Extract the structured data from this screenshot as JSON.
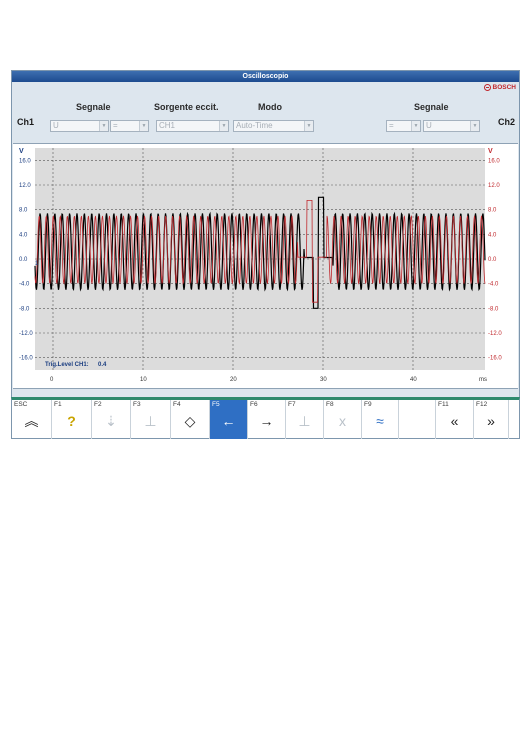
{
  "window": {
    "title": "Oscilloscopio",
    "brand": "BOSCH"
  },
  "channels": {
    "left": "Ch1",
    "right": "Ch2"
  },
  "headers": {
    "segnale_left": "Segnale",
    "sorgente": "Sorgente eccit.",
    "modo": "Modo",
    "segnale_right": "Segnale"
  },
  "controls": {
    "ch1_signal": "U",
    "ch1_coupling": "=",
    "trigger_source": "CH1",
    "mode": "Auto-Time",
    "ch2_coupling": "=",
    "ch2_signal": "U"
  },
  "scope": {
    "unit_left": "V",
    "unit_right": "V",
    "y_ticks_left": [
      "16.0",
      "12.0",
      "8.0",
      "4.0",
      "0.0",
      "-4.0",
      "-8.0",
      "-12.0",
      "-16.0"
    ],
    "y_ticks_right": [
      "16.0",
      "12.0",
      "8.0",
      "4.0",
      "0.0",
      "-4.0",
      "-8.0",
      "-12.0",
      "-16.0"
    ],
    "x_ticks": [
      "0",
      "10",
      "20",
      "30",
      "40"
    ],
    "x_unit": "ms",
    "trigger_marker": "1",
    "trigger_label": "Trig.Level CH1:",
    "trigger_value": "0.4"
  },
  "chart_data": {
    "type": "line",
    "xlabel": "ms",
    "ylabel": "V",
    "xlim": [
      -2,
      48
    ],
    "ylim": [
      -18,
      18
    ],
    "grid": true,
    "series": [
      {
        "color": "#000000",
        "amplitude": 6.2,
        "offset": 1.2,
        "period_ms": 0.82,
        "glitch": {
          "x_ms": 29.5,
          "min_v": -8.0,
          "max_v": 10.0
        }
      },
      {
        "color": "#c0282d",
        "amplitude": 5.5,
        "offset": 1.5,
        "period_ms": 0.78,
        "glitch": {
          "x_ms": 28.8,
          "min_v": -7.0,
          "max_v": 9.5
        }
      }
    ]
  },
  "fkeys": [
    {
      "key": "ESC",
      "icon": "chevron-double-up-icon",
      "glyph": "︽"
    },
    {
      "key": "F1",
      "icon": "help-icon",
      "glyph": "?"
    },
    {
      "key": "F2",
      "icon": "signal-in-icon",
      "glyph": "⇣"
    },
    {
      "key": "F3",
      "icon": "measure-icon",
      "glyph": "⊥"
    },
    {
      "key": "F4",
      "icon": "diamond-icon",
      "glyph": "◇"
    },
    {
      "key": "F5",
      "icon": "arrow-left-icon",
      "glyph": "←"
    },
    {
      "key": "F6",
      "icon": "arrow-right-icon",
      "glyph": "→"
    },
    {
      "key": "F7",
      "icon": "cursor-icon",
      "glyph": "⊥"
    },
    {
      "key": "F8",
      "icon": "x-axis-icon",
      "glyph": "x"
    },
    {
      "key": "F9",
      "icon": "waveform-icon",
      "glyph": "≈"
    },
    {
      "key": "F11",
      "icon": "double-left-icon",
      "glyph": "«"
    },
    {
      "key": "F12",
      "icon": "double-right-icon",
      "glyph": "»"
    }
  ]
}
